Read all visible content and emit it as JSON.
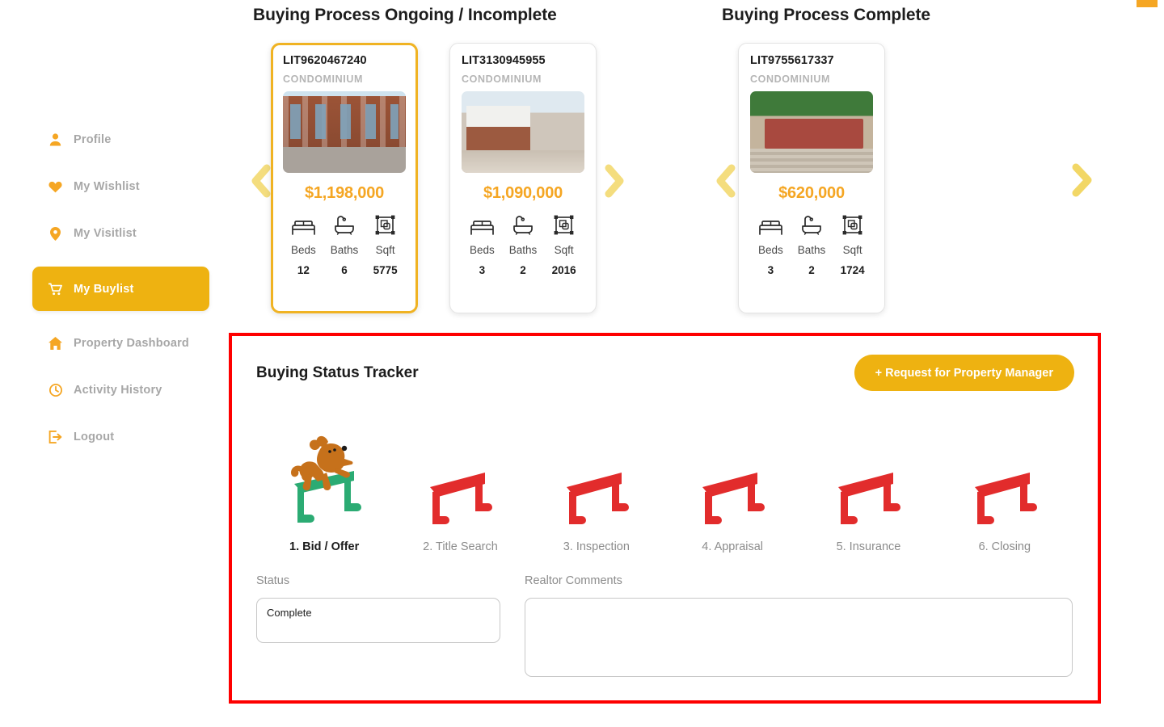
{
  "sidebar": {
    "items": [
      {
        "label": "Profile",
        "icon": "user-icon",
        "active": false
      },
      {
        "label": "My Wishlist",
        "icon": "heart-icon",
        "active": false
      },
      {
        "label": "My Visitlist",
        "icon": "pin-icon",
        "active": false
      },
      {
        "label": "My Buylist",
        "icon": "cart-icon",
        "active": true
      },
      {
        "label": "Property Dashboard",
        "icon": "home-icon",
        "active": false
      },
      {
        "label": "Activity History",
        "icon": "clock-icon",
        "active": false
      },
      {
        "label": "Logout",
        "icon": "logout-icon",
        "active": false
      }
    ]
  },
  "sections": {
    "ongoing_title": "Buying Process Ongoing / Incomplete",
    "complete_title": "Buying Process Complete"
  },
  "carousel": {
    "prev_label": "‹",
    "next_label": "›"
  },
  "cards": [
    {
      "id": "LIT9620467240",
      "type": "CONDOMINIUM",
      "price": "$1,198,000",
      "beds_label": "Beds",
      "beds": "12",
      "baths_label": "Baths",
      "baths": "6",
      "sqft_label": "Sqft",
      "sqft": "5775",
      "selected": true
    },
    {
      "id": "LIT3130945955",
      "type": "CONDOMINIUM",
      "price": "$1,090,000",
      "beds_label": "Beds",
      "beds": "3",
      "baths_label": "Baths",
      "baths": "2",
      "sqft_label": "Sqft",
      "sqft": "2016",
      "selected": false
    },
    {
      "id": "LIT9755617337",
      "type": "CONDOMINIUM",
      "price": "$620,000",
      "beds_label": "Beds",
      "beds": "3",
      "baths_label": "Baths",
      "baths": "2",
      "sqft_label": "Sqft",
      "sqft": "1724",
      "selected": false
    }
  ],
  "tracker": {
    "title": "Buying Status Tracker",
    "request_button": "+ Request for Property Manager",
    "steps": [
      {
        "label": "1. Bid / Offer",
        "state": "current"
      },
      {
        "label": "2. Title Search",
        "state": "pending"
      },
      {
        "label": "3. Inspection",
        "state": "pending"
      },
      {
        "label": "4. Appraisal",
        "state": "pending"
      },
      {
        "label": "5. Insurance",
        "state": "pending"
      },
      {
        "label": "6. Closing",
        "state": "pending"
      }
    ],
    "status_label": "Status",
    "status_value": "Complete",
    "comments_label": "Realtor Comments",
    "comments_value": ""
  },
  "colors": {
    "brand_yellow": "#eeb211",
    "price_orange": "#f5a623",
    "hurdle_red": "#e22c2c",
    "hurdle_green": "#2bab73",
    "alert_border": "#fe0000",
    "dog_brown": "#c6711b"
  }
}
